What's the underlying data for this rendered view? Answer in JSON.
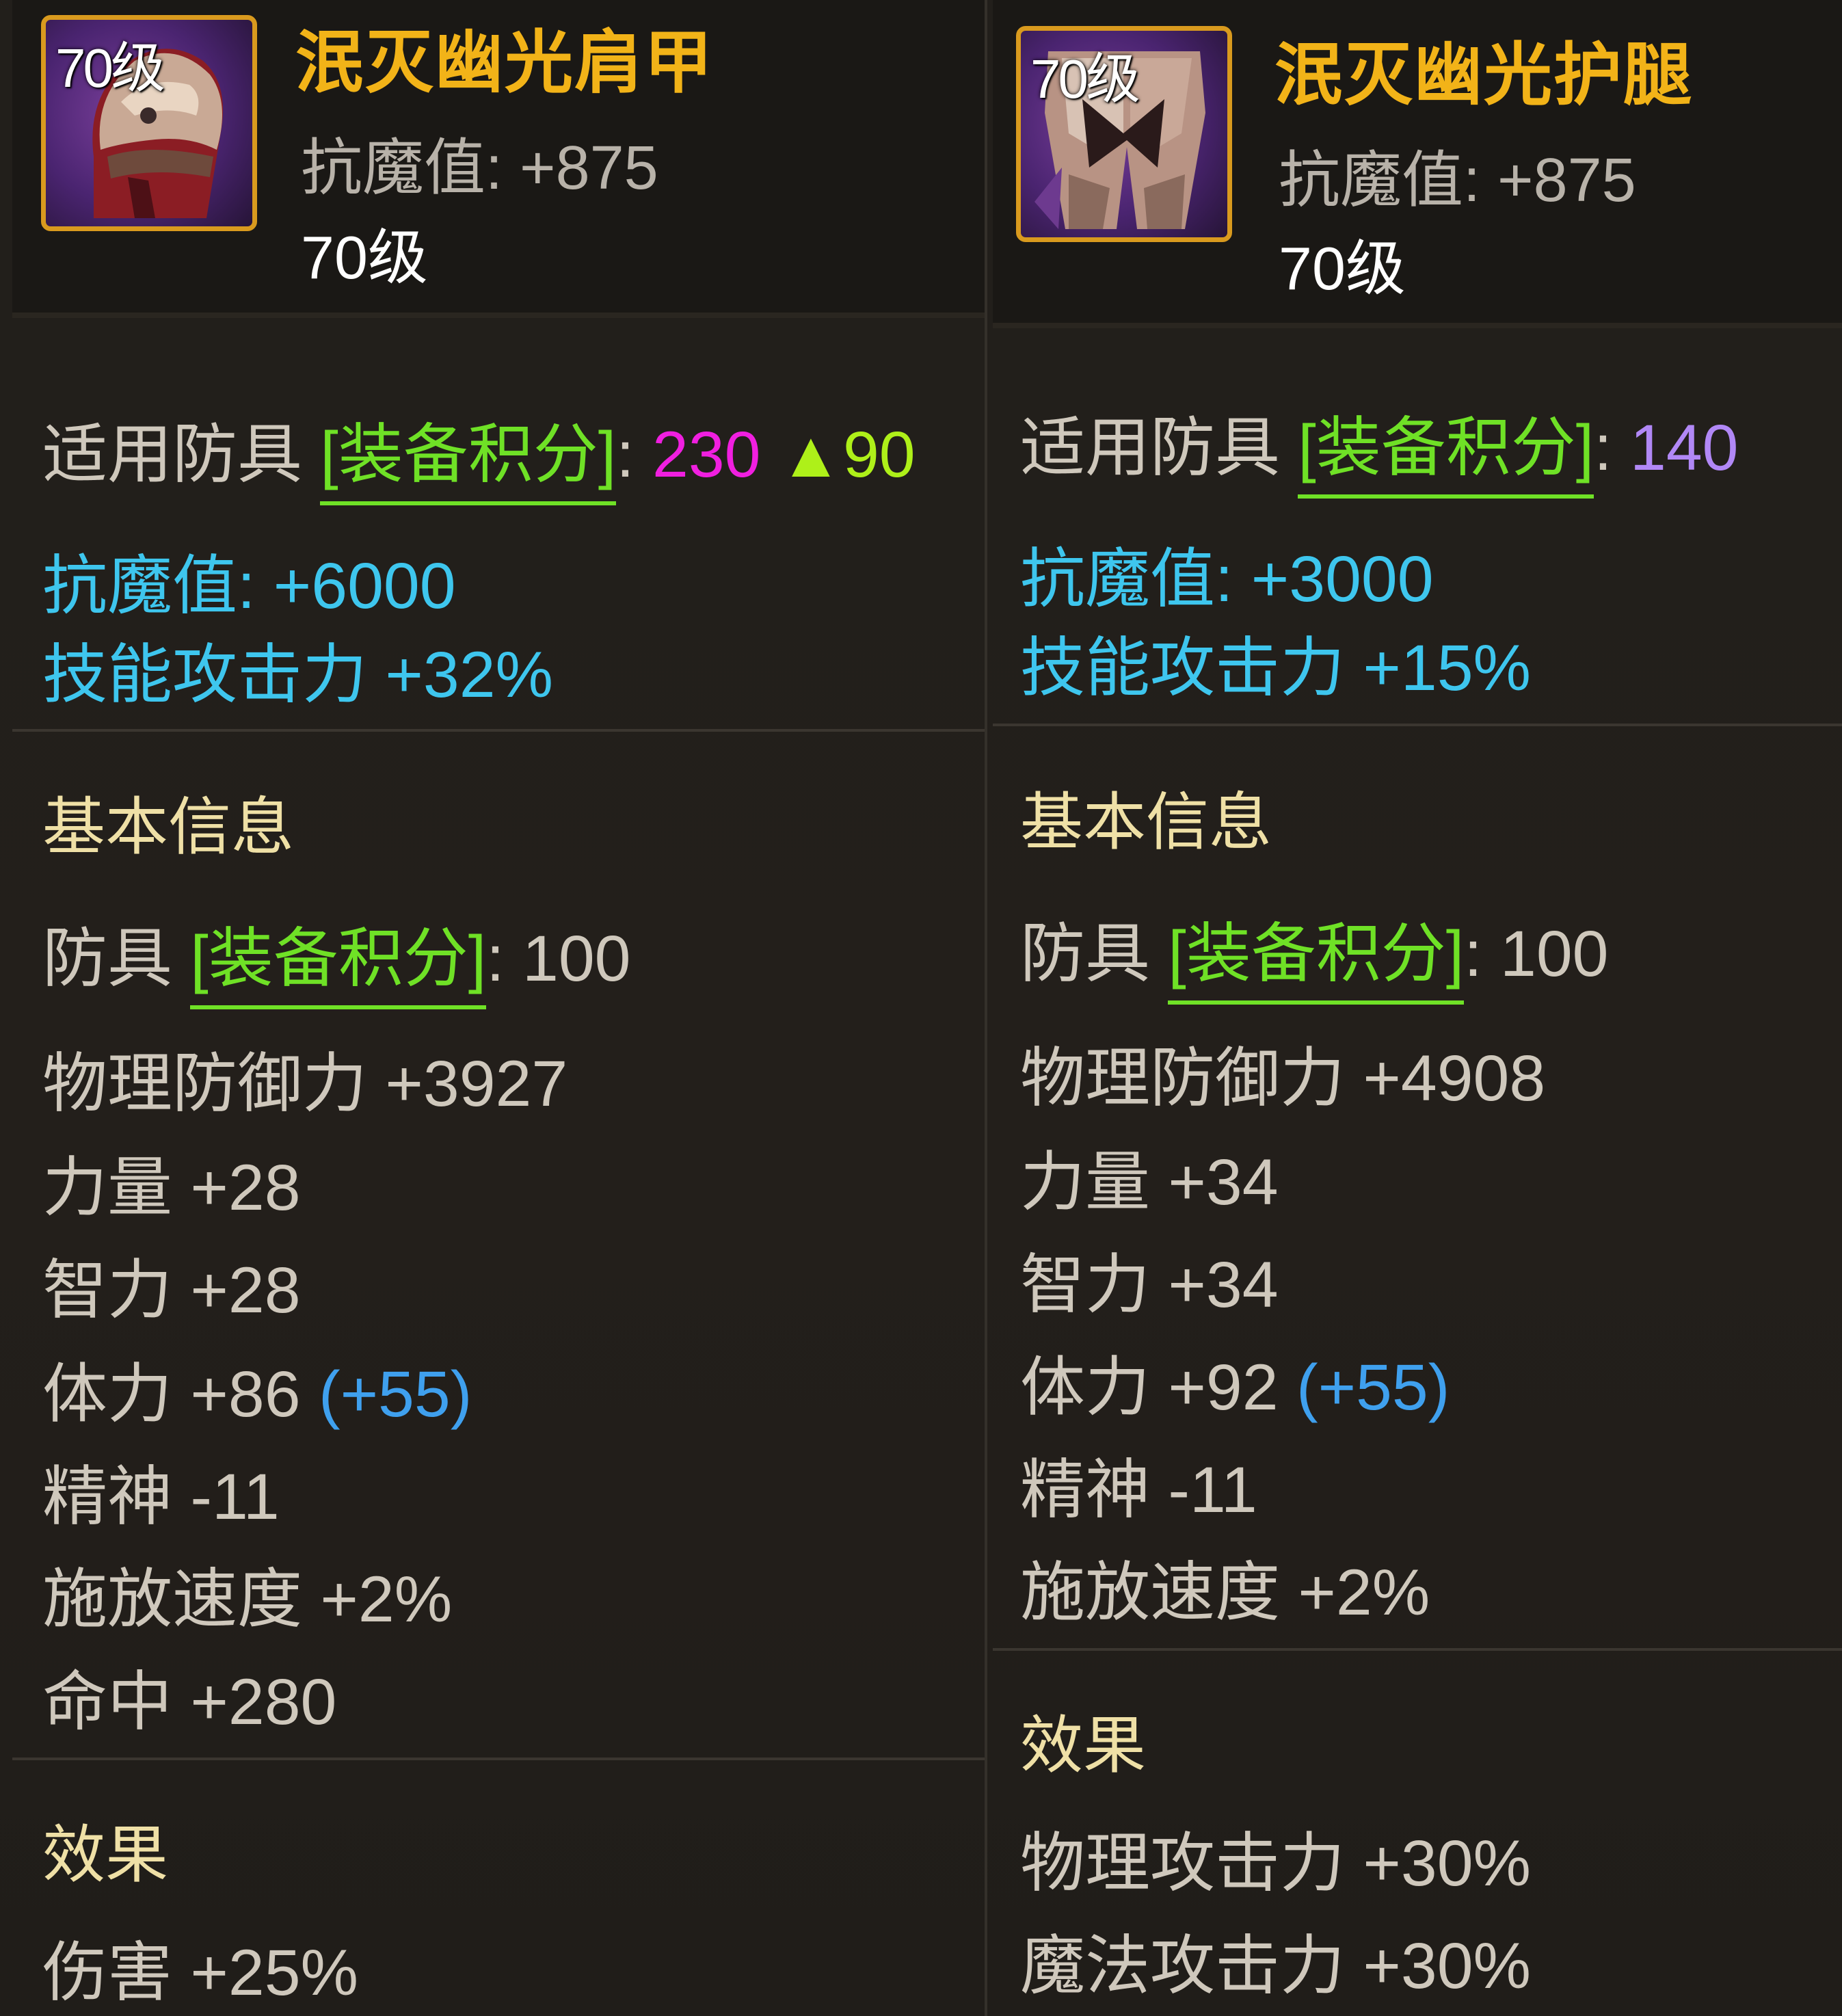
{
  "colors": {
    "item_name": "#f2b318",
    "score_green": "#6fe126",
    "score_magenta": "#f01fe0",
    "score_increase": "#aef019",
    "score_violet": "#b188f6",
    "cyan_stat": "#3ec6ee",
    "bonus_blue": "#3fa0ee",
    "section_heading": "#efe0a6",
    "icon_border": "#d99a1e"
  },
  "left": {
    "icon_level": "70级",
    "name": "泯灭幽光肩甲",
    "header_stat": "抗魔值: +875",
    "level": "70级",
    "score": {
      "prefix": "适用防具 ",
      "bracket": "[装备积分]",
      "colon": ": ",
      "value": "230",
      "increase": "▲90"
    },
    "magic_resist": "抗魔值: +6000",
    "skill_attack": "技能攻击力 +32%",
    "basic_info_title": "基本信息",
    "base_score": {
      "prefix": "防具 ",
      "bracket": "[装备积分]",
      "rest": ": 100"
    },
    "phys_def": "物理防御力 +3927",
    "strength": "力量 +28",
    "intellect": "智力 +28",
    "vitality": {
      "base": "体力 +86 ",
      "bonus": "(+55)"
    },
    "spirit": "精神 -11",
    "cast_speed": "施放速度 +2%",
    "hit": "命中 +280",
    "effects_title": "效果",
    "effect_1": "伤害 +25%"
  },
  "right": {
    "icon_level": "70级",
    "name": "泯灭幽光护腿",
    "header_stat": "抗魔值: +875",
    "level": "70级",
    "score": {
      "prefix": "适用防具 ",
      "bracket": "[装备积分]",
      "colon": ": ",
      "value": "140"
    },
    "magic_resist": "抗魔值: +3000",
    "skill_attack": "技能攻击力 +15%",
    "basic_info_title": "基本信息",
    "base_score": {
      "prefix": "防具 ",
      "bracket": "[装备积分]",
      "rest": ": 100"
    },
    "phys_def": "物理防御力 +4908",
    "strength": "力量 +34",
    "intellect": "智力 +34",
    "vitality": {
      "base": "体力 +92 ",
      "bonus": "(+55)"
    },
    "spirit": "精神 -11",
    "cast_speed": "施放速度 +2%",
    "effects_title": "效果",
    "effect_1": "物理攻击力 +30%",
    "effect_2": "魔法攻击力 +30%"
  }
}
